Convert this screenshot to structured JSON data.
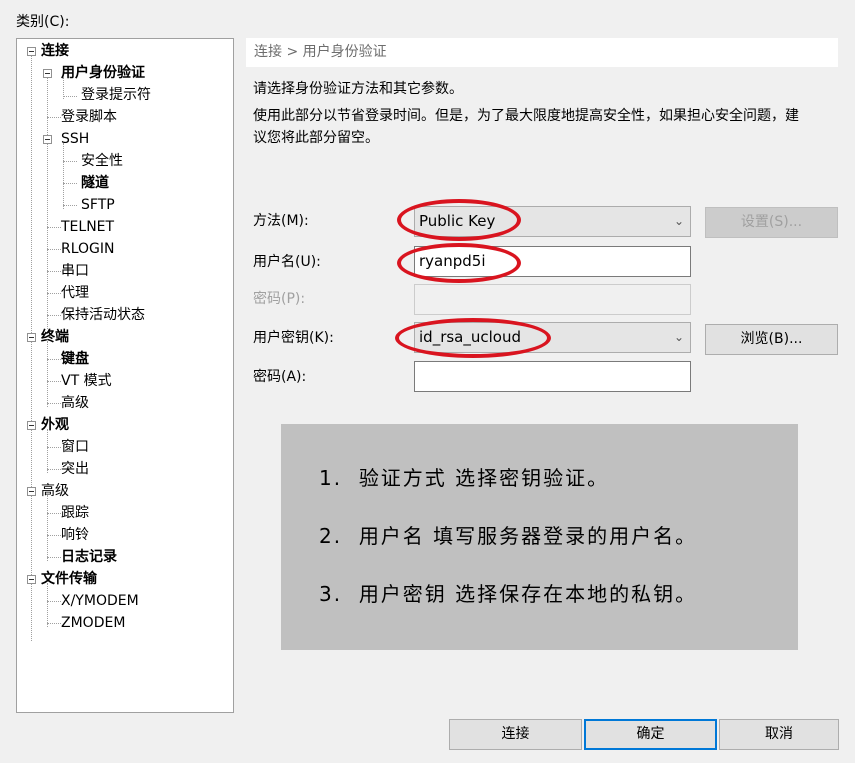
{
  "category_label": "类别(C):",
  "tree": [
    {
      "label": "连接",
      "bold": true
    },
    {
      "label": "用户身份验证",
      "bold": true
    },
    {
      "label": "登录提示符"
    },
    {
      "label": "登录脚本"
    },
    {
      "label": "SSH"
    },
    {
      "label": "安全性"
    },
    {
      "label": "隧道",
      "bold": true
    },
    {
      "label": "SFTP"
    },
    {
      "label": "TELNET"
    },
    {
      "label": "RLOGIN"
    },
    {
      "label": "串口"
    },
    {
      "label": "代理"
    },
    {
      "label": "保持活动状态"
    },
    {
      "label": "终端",
      "bold": true
    },
    {
      "label": "键盘",
      "bold": true
    },
    {
      "label": "VT 模式"
    },
    {
      "label": "高级"
    },
    {
      "label": "外观",
      "bold": true
    },
    {
      "label": "窗口"
    },
    {
      "label": "突出"
    },
    {
      "label": "高级"
    },
    {
      "label": "跟踪"
    },
    {
      "label": "响铃"
    },
    {
      "label": "日志记录",
      "bold": true
    },
    {
      "label": "文件传输",
      "bold": true
    },
    {
      "label": "X/YMODEM"
    },
    {
      "label": "ZMODEM"
    }
  ],
  "breadcrumb": "连接 > 用户身份验证",
  "description_1": "请选择身份验证方法和其它参数。",
  "description_2a": "使用此部分以节省登录时间。但是，为了最大限度地提高安全性，如果担心安全问题，建",
  "description_2b": "议您将此部分留空。",
  "form": {
    "method_label": "方法(M):",
    "method_value": "Public Key",
    "settings_button": "设置(S)...",
    "username_label": "用户名(U):",
    "username_value": "ryanpd5i",
    "password_label": "密码(P):",
    "password_value": "",
    "userkey_label": "用户密钥(K):",
    "userkey_value": "id_rsa_ucloud",
    "browse_button": "浏览(B)...",
    "passphrase_label": "密码(A):",
    "passphrase_value": ""
  },
  "note": {
    "line1_num": "1.",
    "line1": "验证方式 选择密钥验证。",
    "line2_num": "2.",
    "line2": "用户名 填写服务器登录的用户名。",
    "line3_num": "3.",
    "line3": "用户密钥 选择保存在本地的私钥。"
  },
  "buttons": {
    "connect": "连接",
    "ok": "确定",
    "cancel": "取消"
  },
  "colors": {
    "highlight_oval": "#d9141f",
    "default_button_border": "#0078d7",
    "note_background": "#c0c0c0"
  },
  "icons": {
    "dropdown": "chevron-down-icon",
    "tree_toggle": "minus-icon"
  }
}
